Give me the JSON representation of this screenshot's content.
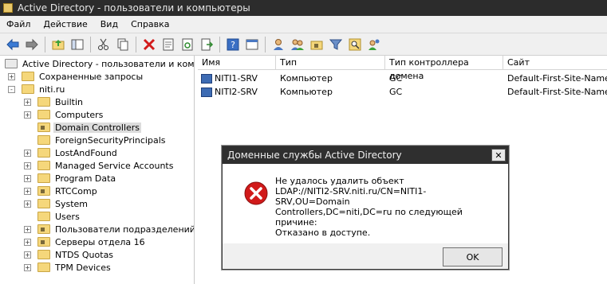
{
  "window": {
    "title": "Active Directory - пользователи и компьютеры"
  },
  "menu": [
    "Файл",
    "Действие",
    "Вид",
    "Справка"
  ],
  "toolbar": {
    "icons": [
      "back-arrow-icon",
      "forward-arrow-icon",
      "up-folder-icon",
      "show-hide-tree-icon",
      "cut-icon",
      "copy-icon",
      "delete-icon",
      "properties-icon",
      "refresh-icon",
      "export-list-icon",
      "help-icon",
      "console-icon",
      "create-user-icon",
      "create-group-icon",
      "create-ou-icon",
      "filter-icon",
      "find-icon",
      "add-to-group-icon"
    ]
  },
  "tree": {
    "root": "Active Directory - пользователи и компьют",
    "items": [
      {
        "label": "Сохраненные запросы",
        "level": 1,
        "expander": "+"
      },
      {
        "label": "niti.ru",
        "level": 1,
        "expander": "-"
      },
      {
        "label": "Builtin",
        "level": 2,
        "expander": "+"
      },
      {
        "label": "Computers",
        "level": 2,
        "expander": "+"
      },
      {
        "label": "Domain Controllers",
        "level": 2,
        "expander": "",
        "selected": true,
        "ou": true
      },
      {
        "label": "ForeignSecurityPrincipals",
        "level": 2,
        "expander": ""
      },
      {
        "label": "LostAndFound",
        "level": 2,
        "expander": "+"
      },
      {
        "label": "Managed Service Accounts",
        "level": 2,
        "expander": "+"
      },
      {
        "label": "Program Data",
        "level": 2,
        "expander": "+"
      },
      {
        "label": "RTCComp",
        "level": 2,
        "expander": "+",
        "ou": true
      },
      {
        "label": "System",
        "level": 2,
        "expander": "+"
      },
      {
        "label": "Users",
        "level": 2,
        "expander": ""
      },
      {
        "label": "Пользователи подразделений НИТ",
        "level": 2,
        "expander": "+",
        "ou": true
      },
      {
        "label": "Серверы отдела 16",
        "level": 2,
        "expander": "+",
        "ou": true
      },
      {
        "label": "NTDS Quotas",
        "level": 2,
        "expander": "+"
      },
      {
        "label": "TPM Devices",
        "level": 2,
        "expander": "+"
      }
    ]
  },
  "list": {
    "columns": [
      "Имя",
      "Тип",
      "Тип контроллера домена",
      "Сайт"
    ],
    "rows": [
      {
        "name": "NITI1-SRV",
        "type": "Компьютер",
        "dc_type": "GC",
        "site": "Default-First-Site-Name"
      },
      {
        "name": "NITI2-SRV",
        "type": "Компьютер",
        "dc_type": "GC",
        "site": "Default-First-Site-Name"
      }
    ]
  },
  "dialog": {
    "title": "Доменные службы Active Directory",
    "close": "✕",
    "message_lines": [
      "Не удалось удалить объект",
      "LDAP://NITI2-SRV.niti.ru/CN=NITI1-SRV,OU=Domain",
      "Controllers,DC=niti,DC=ru по следующей причине:",
      "Отказано в доступе."
    ],
    "ok": "OK"
  }
}
